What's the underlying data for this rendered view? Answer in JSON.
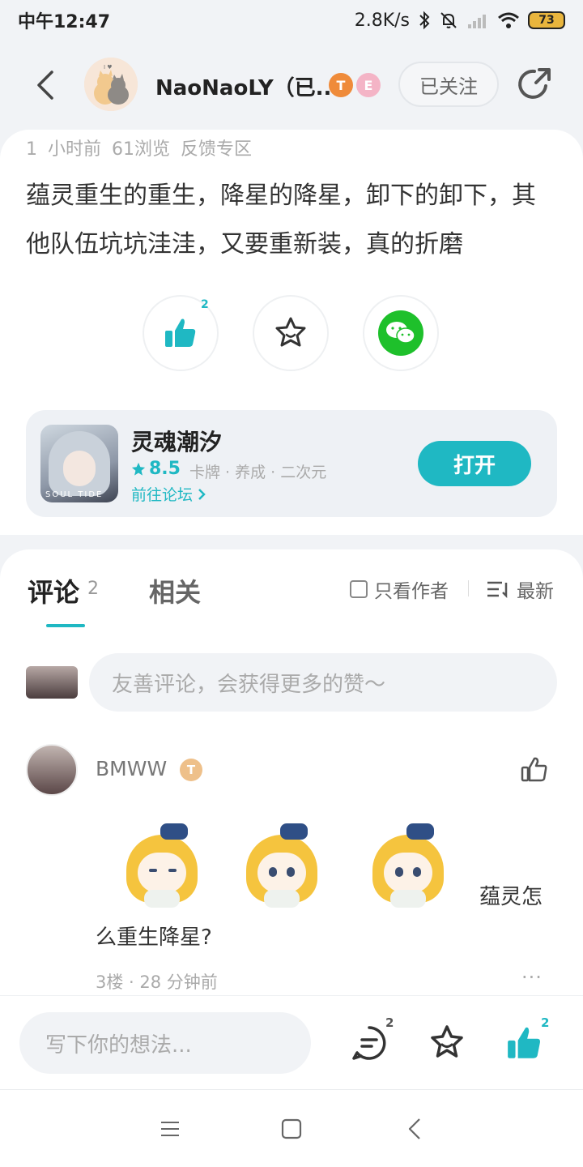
{
  "status_bar": {
    "time": "中午12:47",
    "network_speed": "2.8K/s",
    "battery": "73"
  },
  "header": {
    "author_name": "NaoNaoLY（已...",
    "badge_t": "T",
    "badge_e": "E",
    "follow_label": "已关注"
  },
  "post": {
    "meta": "1 小时前  61浏览  反馈专区",
    "text": "蕴灵重生的重生，降星的降星，卸下的卸下，其他队伍坑坑洼洼，又要重新装，真的折磨",
    "like_count": "2"
  },
  "game": {
    "name": "灵魂潮汐",
    "rating": "8.5",
    "tags": "卡牌 · 养成 · 二次元",
    "forum_link": "前往论坛",
    "open_label": "打开",
    "icon_logo": "SOUL TIDE"
  },
  "comments_section": {
    "tab_comments": "评论",
    "comments_count": "2",
    "tab_related": "相关",
    "only_author": "只看作者",
    "sort": "最新",
    "input_placeholder": "友善评论，会获得更多的赞～"
  },
  "comment": {
    "user": "BMWW",
    "badge": "T",
    "text_tail": "蕴灵怎",
    "text_line2": "么重生降星?",
    "meta": "3楼 · 28 分钟前",
    "more": "···"
  },
  "bottom_bar": {
    "input_placeholder": "写下你的想法...",
    "comment_count": "2",
    "like_count": "2"
  },
  "colors": {
    "accent": "#1fb8c3",
    "wechat": "#1ec02b",
    "background": "#f1f3f6"
  }
}
